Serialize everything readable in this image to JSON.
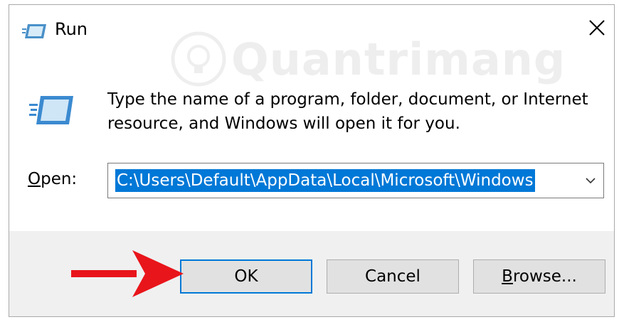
{
  "window": {
    "title": "Run",
    "close_icon": "close-icon"
  },
  "watermark": {
    "text": "Quantrimang"
  },
  "body": {
    "message": "Type the name of a program, folder, document, or Internet resource, and Windows will open it for you."
  },
  "open_field": {
    "label_underlined": "O",
    "label_rest": "pen:",
    "value": "C:\\Users\\Default\\AppData\\Local\\Microsoft\\Windows"
  },
  "buttons": {
    "ok": "OK",
    "cancel": "Cancel",
    "browse_underlined": "B",
    "browse_rest": "rowse..."
  },
  "colors": {
    "selection": "#0078d7",
    "footer": "#f0f0f0",
    "arrow": "#e8151b"
  }
}
